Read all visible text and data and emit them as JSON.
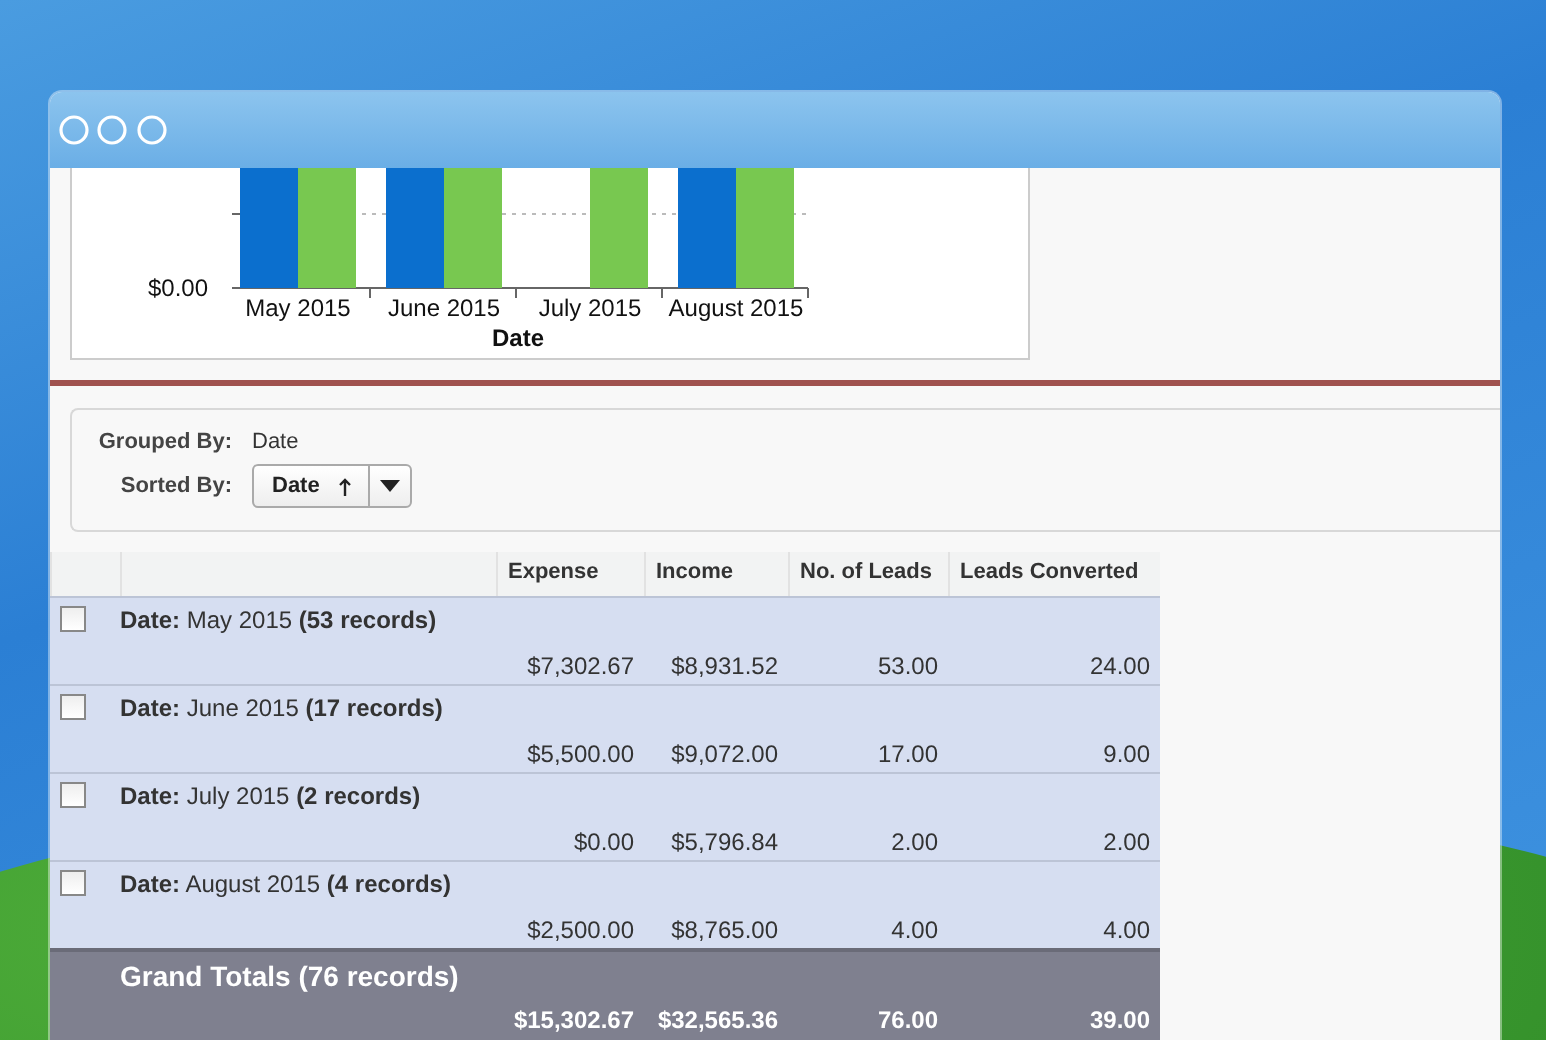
{
  "chart": {
    "y_tick": "$0.00",
    "xlabel": "Date",
    "categories": [
      {
        "label": "May 2015",
        "expense_bar": true,
        "income_bar": true
      },
      {
        "label": "June 2015",
        "expense_bar": true,
        "income_bar": true
      },
      {
        "label": "July 2015",
        "expense_bar": false,
        "income_bar": true
      },
      {
        "label": "August 2015",
        "expense_bar": true,
        "income_bar": true
      }
    ]
  },
  "filters": {
    "grouped_by_label": "Grouped By:",
    "grouped_by_value": "Date",
    "sorted_by_label": "Sorted By:",
    "sorted_by_value": "Date"
  },
  "table": {
    "columns": [
      "Expense",
      "Income",
      "No. of Leads",
      "Leads Converted"
    ],
    "groups": [
      {
        "title": "**Date:** May 2015 **(53 records)**",
        "checked": false,
        "values": [
          "$7,302.67",
          "$8,931.52",
          "53.00",
          "24.00"
        ]
      },
      {
        "title": "**Date:** June 2015 **(17 records)**",
        "checked": false,
        "values": [
          "$5,500.00",
          "$9,072.00",
          "17.00",
          "9.00"
        ]
      },
      {
        "title": "**Date:** July 2015 **(2 records)**",
        "checked": false,
        "values": [
          "$0.00",
          "$5,796.84",
          "2.00",
          "2.00"
        ]
      },
      {
        "title": "**Date:** August 2015 **(4 records)**",
        "checked": false,
        "values": [
          "$2,500.00",
          "$8,765.00",
          "4.00",
          "4.00"
        ]
      }
    ],
    "grand_totals": {
      "title": "Grand Totals (76 records)",
      "values": [
        "$15,302.67",
        "$32,565.36",
        "76.00",
        "39.00"
      ]
    }
  }
}
